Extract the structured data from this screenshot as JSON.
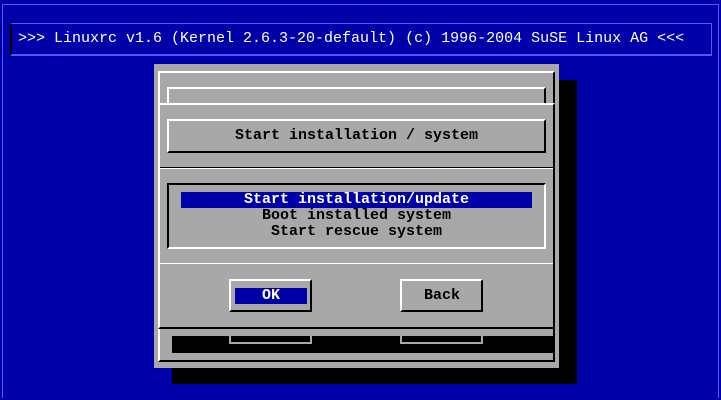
{
  "header": {
    "title": ">>> Linuxrc v1.6 (Kernel 2.6.3-20-default) (c) 1996-2004 SuSE Linux AG <<<"
  },
  "dialog": {
    "title": "Start installation / system",
    "items": [
      {
        "label": "Start installation/update",
        "selected": true
      },
      {
        "label": "Boot installed system",
        "selected": false
      },
      {
        "label": "Start rescue system",
        "selected": false
      }
    ],
    "ok_label": "OK",
    "back_label": "Back"
  },
  "colors": {
    "background": "#0000a8",
    "dialog": "#a8a8a8",
    "highlight": "#0000a8"
  }
}
